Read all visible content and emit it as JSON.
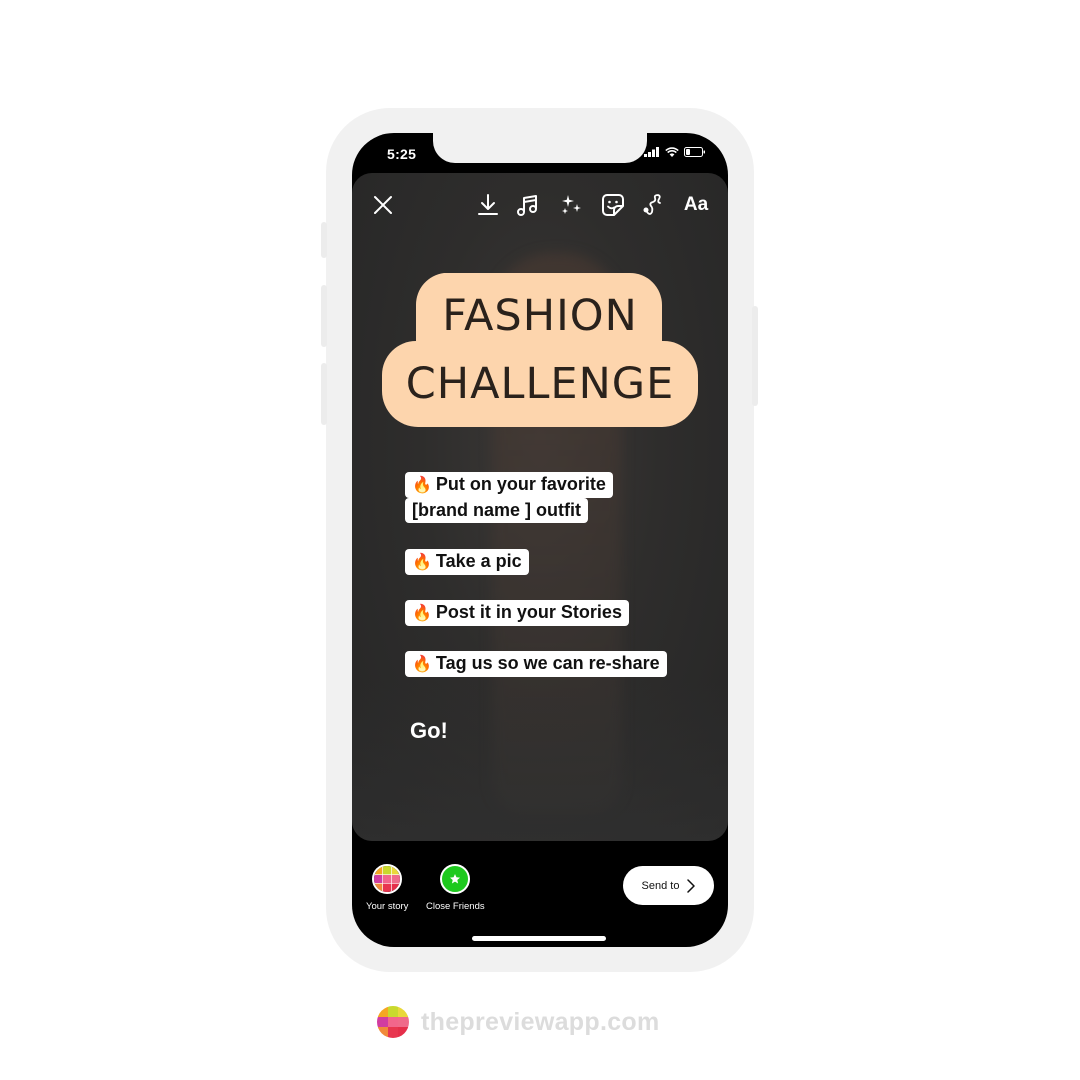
{
  "status_bar": {
    "time": "5:25",
    "icons": [
      "signal-icon",
      "wifi-icon",
      "battery-icon"
    ]
  },
  "toolbar": {
    "close_icon": "close-icon",
    "tools": [
      {
        "name": "download-icon",
        "label": "Download"
      },
      {
        "name": "music-icon",
        "label": "Music"
      },
      {
        "name": "effects-icon",
        "label": "Effects"
      },
      {
        "name": "sticker-icon",
        "label": "Stickers"
      },
      {
        "name": "draw-icon",
        "label": "Draw"
      },
      {
        "name": "text-icon",
        "label": "Aa"
      }
    ]
  },
  "story": {
    "title_line1": "FASHION",
    "title_line2": "CHALLENGE",
    "title_bg_color": "#fdd5ad",
    "title_text_color": "#2a221c",
    "steps": [
      {
        "emoji": "🔥",
        "line1": "Put on your favorite",
        "line2": "[brand name ] outfit"
      },
      {
        "emoji": "🔥",
        "line1": "Take a pic"
      },
      {
        "emoji": "🔥",
        "line1": "Post it in your Stories"
      },
      {
        "emoji": "🔥",
        "line1": "Tag us so we can re-share"
      }
    ],
    "closing_text": "Go!"
  },
  "bottom_bar": {
    "your_story_label": "Your story",
    "close_friends_label": "Close Friends",
    "close_friends_color": "#1ec91e",
    "send_to_label": "Send to"
  },
  "brand": {
    "text": "thepreviewapp.com",
    "logo_colors": [
      "#f5a623",
      "#c9d92d",
      "#e9d83a",
      "#d13da0",
      "#f2668b",
      "#ef6b8a",
      "#f18a3a",
      "#e8364f",
      "#e52f4a"
    ]
  }
}
